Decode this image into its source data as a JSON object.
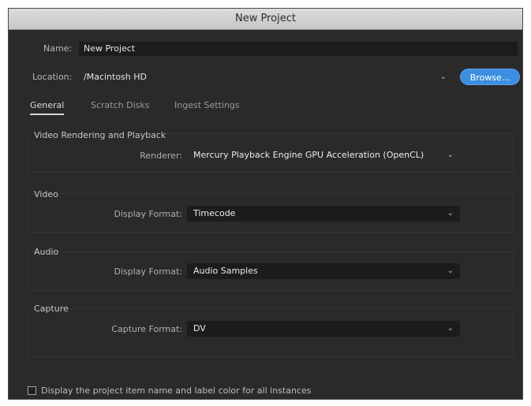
{
  "window": {
    "title": "New Project"
  },
  "form": {
    "name_label": "Name:",
    "name_value": "New Project",
    "location_label": "Location:",
    "location_value": "/Macintosh HD",
    "browse_label": "Browse..."
  },
  "tabs": [
    {
      "label": "General",
      "active": true
    },
    {
      "label": "Scratch Disks",
      "active": false
    },
    {
      "label": "Ingest Settings",
      "active": false
    }
  ],
  "sections": {
    "video_rendering": {
      "title": "Video Rendering and Playback",
      "field_label": "Renderer:",
      "value": "Mercury Playback Engine GPU Acceleration (OpenCL)"
    },
    "video": {
      "title": "Video",
      "field_label": "Display Format:",
      "value": "Timecode"
    },
    "audio": {
      "title": "Audio",
      "field_label": "Display Format:",
      "value": "Audio Samples"
    },
    "capture": {
      "title": "Capture",
      "field_label": "Capture Format:",
      "value": "DV"
    }
  },
  "footer": {
    "checkbox_label": "Display the project item name and label color for all instances",
    "checked": false
  },
  "colors": {
    "background": "#2a2a2a",
    "accent": "#3c8fe0",
    "titlebar": "#d0d0d0"
  },
  "icons": {
    "dropdown": "chevron-down-icon",
    "checkbox": "checkbox-icon"
  }
}
